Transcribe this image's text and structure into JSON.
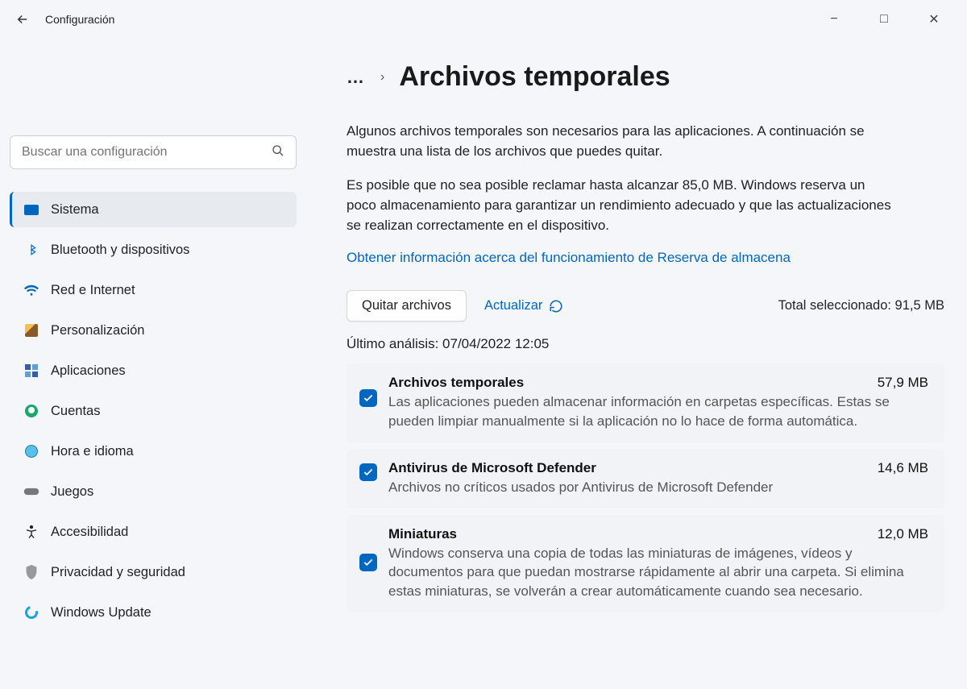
{
  "app": {
    "title": "Configuración"
  },
  "window_controls": {
    "minimize": "−",
    "maximize": "□",
    "close": "✕"
  },
  "search": {
    "placeholder": "Buscar una configuración"
  },
  "sidebar": {
    "items": [
      {
        "label": "Sistema",
        "icon": "monitor-icon",
        "selected": true
      },
      {
        "label": "Bluetooth y dispositivos",
        "icon": "bluetooth-icon"
      },
      {
        "label": "Red e Internet",
        "icon": "wifi-icon"
      },
      {
        "label": "Personalización",
        "icon": "brush-icon"
      },
      {
        "label": "Aplicaciones",
        "icon": "apps-icon"
      },
      {
        "label": "Cuentas",
        "icon": "user-icon"
      },
      {
        "label": "Hora e idioma",
        "icon": "clock-icon"
      },
      {
        "label": "Juegos",
        "icon": "gamepad-icon"
      },
      {
        "label": "Accesibilidad",
        "icon": "accessibility-icon"
      },
      {
        "label": "Privacidad y seguridad",
        "icon": "shield-icon"
      },
      {
        "label": "Windows Update",
        "icon": "update-icon"
      }
    ]
  },
  "breadcrumb": {
    "ellipsis": "…",
    "chevron": "›",
    "title": "Archivos temporales"
  },
  "description": {
    "p1": "Algunos archivos temporales son necesarios para las aplicaciones. A continuación se muestra una lista de los archivos que puedes quitar.",
    "p2": "Es posible que no sea posible reclamar hasta alcanzar 85,0 MB. Windows reserva un poco almacenamiento para garantizar un rendimiento adecuado y que las actualizaciones se realizan correctamente en el dispositivo.",
    "link": "Obtener información acerca del funcionamiento de Reserva de almacena"
  },
  "actions": {
    "remove_label": "Quitar archivos",
    "refresh_label": "Actualizar",
    "total_label": "Total seleccionado: 91,5 MB"
  },
  "scan": {
    "label": "Último análisis: 07/04/2022 12:05"
  },
  "items": [
    {
      "title": "Archivos temporales",
      "size": "57,9 MB",
      "desc": "Las aplicaciones pueden almacenar información en carpetas específicas. Estas se pueden limpiar manualmente si la aplicación no lo hace de forma automática.",
      "checked": true
    },
    {
      "title": "Antivirus de Microsoft Defender",
      "size": "14,6 MB",
      "desc": "Archivos no críticos usados por Antivirus de Microsoft Defender",
      "checked": true
    },
    {
      "title": "Miniaturas",
      "size": "12,0 MB",
      "desc": "Windows conserva una copia de todas las miniaturas de imágenes, vídeos y documentos para que puedan mostrarse rápidamente al abrir una carpeta. Si elimina estas miniaturas, se volverán a crear automáticamente cuando sea necesario.",
      "checked": true
    }
  ]
}
